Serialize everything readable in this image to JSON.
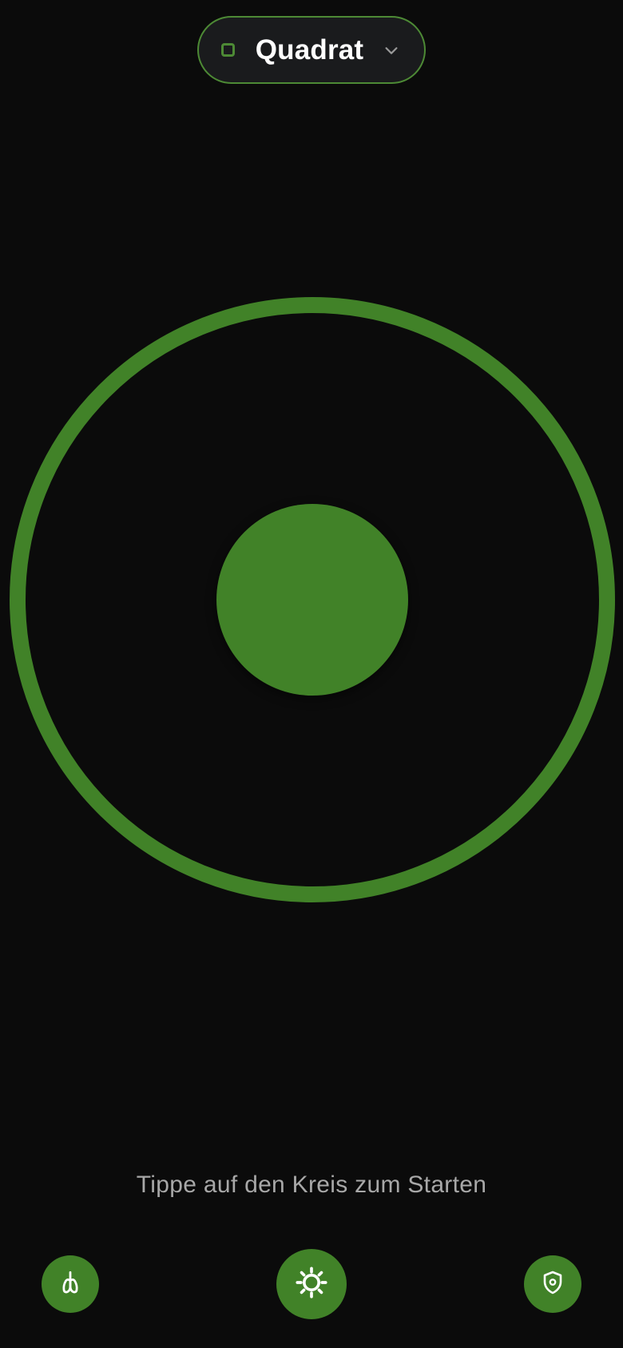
{
  "mode_selector": {
    "label": "Quadrat",
    "shape_icon": "square-icon",
    "dropdown_icon": "chevron-down-icon"
  },
  "breathing_circle": {
    "outer_ring_color": "#418228",
    "inner_circle_color": "#418228"
  },
  "hint_text": "Tippe auf den Kreis zum Starten",
  "bottom_bar": {
    "left_button_icon": "lungs-icon",
    "center_button_icon": "sun-icon",
    "right_button_icon": "shield-icon"
  },
  "colors": {
    "accent": "#418228",
    "background": "#0b0b0b",
    "pill_background": "#1a1b1d"
  }
}
